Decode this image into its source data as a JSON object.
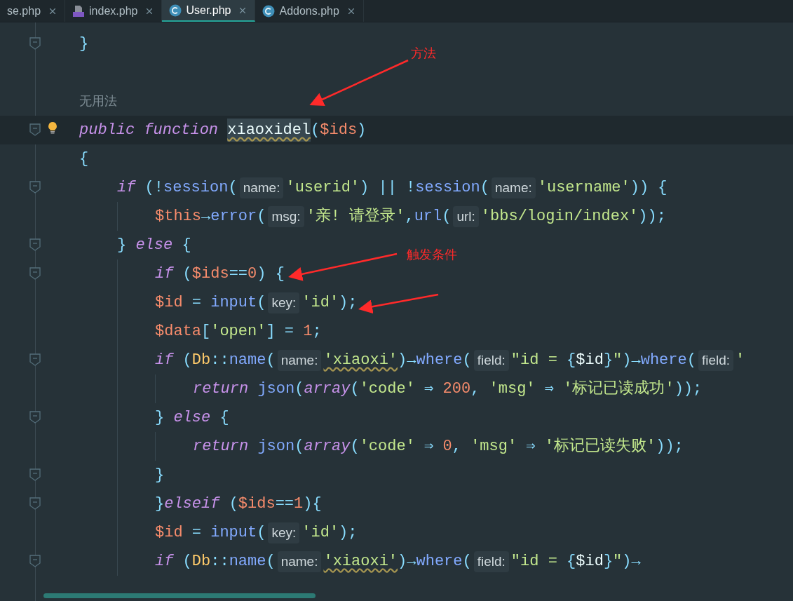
{
  "tabs": [
    {
      "label": "se.php",
      "kind": "plain",
      "selected": false
    },
    {
      "label": "index.php",
      "kind": "php",
      "selected": false
    },
    {
      "label": "User.php",
      "kind": "class",
      "selected": true
    },
    {
      "label": "Addons.php",
      "kind": "class",
      "selected": false
    }
  ],
  "lines": [
    {
      "kind": "code",
      "fold": true,
      "current": false,
      "bulb": false,
      "tokens": [
        {
          "kind": "op",
          "text": "}"
        }
      ]
    },
    {
      "kind": "blank",
      "fold": false,
      "current": false,
      "bulb": false
    },
    {
      "kind": "note",
      "fold": false,
      "current": false,
      "bulb": false,
      "text": "无用法"
    },
    {
      "kind": "code",
      "fold": true,
      "current": true,
      "bulb": true,
      "tokens": [
        {
          "kind": "kw",
          "text": "public "
        },
        {
          "kind": "kw",
          "text": "function "
        },
        {
          "kind": "def",
          "text": "xiaoxidel"
        },
        {
          "kind": "op",
          "text": "("
        },
        {
          "kind": "var",
          "text": "$ids"
        },
        {
          "kind": "op",
          "text": ")"
        }
      ]
    },
    {
      "kind": "code",
      "fold": false,
      "current": false,
      "bulb": false,
      "tokens": [
        {
          "kind": "op",
          "text": "{"
        }
      ],
      "children": [
        {
          "kind": "code",
          "fold": true,
          "current": false,
          "bulb": false,
          "tokens": [
            {
              "kind": "kw",
              "text": "if "
            },
            {
              "kind": "op",
              "text": "(!"
            },
            {
              "kind": "fn",
              "text": "session"
            },
            {
              "kind": "op",
              "text": "("
            },
            {
              "kind": "hint",
              "text": "name:"
            },
            {
              "kind": "str",
              "text": "'userid'"
            },
            {
              "kind": "op",
              "text": ") || !"
            },
            {
              "kind": "fn",
              "text": "session"
            },
            {
              "kind": "op",
              "text": "("
            },
            {
              "kind": "hint",
              "text": "name:"
            },
            {
              "kind": "str",
              "text": "'username'"
            },
            {
              "kind": "op",
              "text": ")) {"
            }
          ],
          "children": [
            {
              "kind": "code",
              "fold": false,
              "current": false,
              "bulb": false,
              "tokens": [
                {
                  "kind": "var",
                  "text": "$this"
                },
                {
                  "kind": "op",
                  "text": "→"
                },
                {
                  "kind": "fn",
                  "text": "error"
                },
                {
                  "kind": "op",
                  "text": "("
                },
                {
                  "kind": "hint",
                  "text": "msg:"
                },
                {
                  "kind": "str",
                  "text": "'亲! 请登录'"
                },
                {
                  "kind": "op",
                  "text": ","
                },
                {
                  "kind": "fn",
                  "text": "url"
                },
                {
                  "kind": "op",
                  "text": "("
                },
                {
                  "kind": "hint",
                  "text": "url:"
                },
                {
                  "kind": "str",
                  "text": "'bbs/login/index'"
                },
                {
                  "kind": "op",
                  "text": "));"
                }
              ]
            }
          ]
        },
        {
          "kind": "code",
          "fold": true,
          "current": false,
          "bulb": false,
          "tokens": [
            {
              "kind": "op",
              "text": "} "
            },
            {
              "kind": "kw",
              "text": "else"
            },
            {
              "kind": "op",
              "text": " {"
            }
          ],
          "children": [
            {
              "kind": "code",
              "fold": true,
              "current": false,
              "bulb": false,
              "tokens": [
                {
                  "kind": "kw",
                  "text": "if "
                },
                {
                  "kind": "op",
                  "text": "("
                },
                {
                  "kind": "var",
                  "text": "$ids"
                },
                {
                  "kind": "op",
                  "text": "=="
                },
                {
                  "kind": "num",
                  "text": "0"
                },
                {
                  "kind": "op",
                  "text": ") {"
                }
              ]
            },
            {
              "kind": "code",
              "fold": false,
              "current": false,
              "bulb": false,
              "tokens": [
                {
                  "kind": "var",
                  "text": "$id"
                },
                {
                  "kind": "op",
                  "text": " = "
                },
                {
                  "kind": "fn",
                  "text": "input"
                },
                {
                  "kind": "op",
                  "text": "("
                },
                {
                  "kind": "hint",
                  "text": "key:"
                },
                {
                  "kind": "str",
                  "text": "'id'"
                },
                {
                  "kind": "op",
                  "text": ");"
                }
              ]
            },
            {
              "kind": "code",
              "fold": false,
              "current": false,
              "bulb": false,
              "tokens": [
                {
                  "kind": "var",
                  "text": "$data"
                },
                {
                  "kind": "op",
                  "text": "["
                },
                {
                  "kind": "str",
                  "text": "'open'"
                },
                {
                  "kind": "op",
                  "text": "] = "
                },
                {
                  "kind": "num",
                  "text": "1"
                },
                {
                  "kind": "op",
                  "text": ";"
                }
              ]
            },
            {
              "kind": "code",
              "fold": true,
              "current": false,
              "bulb": false,
              "tokens": [
                {
                  "kind": "kw",
                  "text": "if "
                },
                {
                  "kind": "op",
                  "text": "("
                },
                {
                  "kind": "cls",
                  "text": "Db"
                },
                {
                  "kind": "op",
                  "text": "::"
                },
                {
                  "kind": "fn",
                  "text": "name"
                },
                {
                  "kind": "op",
                  "text": "("
                },
                {
                  "kind": "hint",
                  "text": "name:"
                },
                {
                  "kind": "strw",
                  "text": "'xiaoxi'"
                },
                {
                  "kind": "op",
                  "text": ")→"
                },
                {
                  "kind": "fn",
                  "text": "where"
                },
                {
                  "kind": "op",
                  "text": "("
                },
                {
                  "kind": "hint",
                  "text": "field:"
                },
                {
                  "kind": "str",
                  "text": "\"id = "
                },
                {
                  "kind": "op",
                  "text": "{"
                },
                {
                  "kind": "plain",
                  "text": "$id"
                },
                {
                  "kind": "op",
                  "text": "}"
                },
                {
                  "kind": "str",
                  "text": "\""
                },
                {
                  "kind": "op",
                  "text": ")→"
                },
                {
                  "kind": "fn",
                  "text": "where"
                },
                {
                  "kind": "op",
                  "text": "("
                },
                {
                  "kind": "hint",
                  "text": "field:"
                },
                {
                  "kind": "str",
                  "text": "'"
                }
              ],
              "children": [
                {
                  "kind": "code",
                  "fold": false,
                  "current": false,
                  "bulb": false,
                  "tokens": [
                    {
                      "kind": "kw",
                      "text": "return "
                    },
                    {
                      "kind": "fn",
                      "text": "json"
                    },
                    {
                      "kind": "op",
                      "text": "("
                    },
                    {
                      "kind": "kw",
                      "text": "array"
                    },
                    {
                      "kind": "op",
                      "text": "("
                    },
                    {
                      "kind": "str",
                      "text": "'code'"
                    },
                    {
                      "kind": "op",
                      "text": " ⇒ "
                    },
                    {
                      "kind": "num",
                      "text": "200"
                    },
                    {
                      "kind": "op",
                      "text": ", "
                    },
                    {
                      "kind": "str",
                      "text": "'msg'"
                    },
                    {
                      "kind": "op",
                      "text": " ⇒ "
                    },
                    {
                      "kind": "str",
                      "text": "'标记已读成功'"
                    },
                    {
                      "kind": "op",
                      "text": "));"
                    }
                  ]
                }
              ]
            },
            {
              "kind": "code",
              "fold": true,
              "current": false,
              "bulb": false,
              "tokens": [
                {
                  "kind": "op",
                  "text": "} "
                },
                {
                  "kind": "kw",
                  "text": "else"
                },
                {
                  "kind": "op",
                  "text": " {"
                }
              ],
              "children": [
                {
                  "kind": "code",
                  "fold": false,
                  "current": false,
                  "bulb": false,
                  "tokens": [
                    {
                      "kind": "kw",
                      "text": "return "
                    },
                    {
                      "kind": "fn",
                      "text": "json"
                    },
                    {
                      "kind": "op",
                      "text": "("
                    },
                    {
                      "kind": "kw",
                      "text": "array"
                    },
                    {
                      "kind": "op",
                      "text": "("
                    },
                    {
                      "kind": "str",
                      "text": "'code'"
                    },
                    {
                      "kind": "op",
                      "text": " ⇒ "
                    },
                    {
                      "kind": "num",
                      "text": "0"
                    },
                    {
                      "kind": "op",
                      "text": ", "
                    },
                    {
                      "kind": "str",
                      "text": "'msg'"
                    },
                    {
                      "kind": "op",
                      "text": " ⇒ "
                    },
                    {
                      "kind": "str",
                      "text": "'标记已读失败'"
                    },
                    {
                      "kind": "op",
                      "text": "));"
                    }
                  ]
                }
              ]
            },
            {
              "kind": "code",
              "fold": true,
              "current": false,
              "bulb": false,
              "tokens": [
                {
                  "kind": "op",
                  "text": "}"
                }
              ]
            },
            {
              "kind": "code",
              "fold": true,
              "current": false,
              "bulb": false,
              "tokens": [
                {
                  "kind": "op",
                  "text": "}"
                },
                {
                  "kind": "kw",
                  "text": "elseif "
                },
                {
                  "kind": "op",
                  "text": "("
                },
                {
                  "kind": "var",
                  "text": "$ids"
                },
                {
                  "kind": "op",
                  "text": "=="
                },
                {
                  "kind": "num",
                  "text": "1"
                },
                {
                  "kind": "op",
                  "text": "){"
                }
              ]
            },
            {
              "kind": "code",
              "fold": false,
              "current": false,
              "bulb": false,
              "tokens": [
                {
                  "kind": "var",
                  "text": "$id"
                },
                {
                  "kind": "op",
                  "text": " = "
                },
                {
                  "kind": "fn",
                  "text": "input"
                },
                {
                  "kind": "op",
                  "text": "("
                },
                {
                  "kind": "hint",
                  "text": "key:"
                },
                {
                  "kind": "str",
                  "text": "'id'"
                },
                {
                  "kind": "op",
                  "text": ");"
                }
              ]
            },
            {
              "kind": "code",
              "fold": true,
              "current": false,
              "bulb": false,
              "tokens": [
                {
                  "kind": "kw",
                  "text": "if "
                },
                {
                  "kind": "op",
                  "text": "("
                },
                {
                  "kind": "cls",
                  "text": "Db"
                },
                {
                  "kind": "op",
                  "text": "::"
                },
                {
                  "kind": "fn",
                  "text": "name"
                },
                {
                  "kind": "op",
                  "text": "("
                },
                {
                  "kind": "hint",
                  "text": "name:"
                },
                {
                  "kind": "strw",
                  "text": "'xiaoxi'"
                },
                {
                  "kind": "op",
                  "text": ")→"
                },
                {
                  "kind": "fn",
                  "text": "where"
                },
                {
                  "kind": "op",
                  "text": "("
                },
                {
                  "kind": "hint",
                  "text": "field:"
                },
                {
                  "kind": "str",
                  "text": "\"id = "
                },
                {
                  "kind": "op",
                  "text": "{"
                },
                {
                  "kind": "plain",
                  "text": "$id"
                },
                {
                  "kind": "op",
                  "text": "}"
                },
                {
                  "kind": "str",
                  "text": "\""
                },
                {
                  "kind": "op",
                  "text": ")→"
                }
              ]
            }
          ]
        }
      ]
    }
  ],
  "annotations": [
    {
      "text": "方法"
    },
    {
      "text": "触发条件"
    }
  ]
}
